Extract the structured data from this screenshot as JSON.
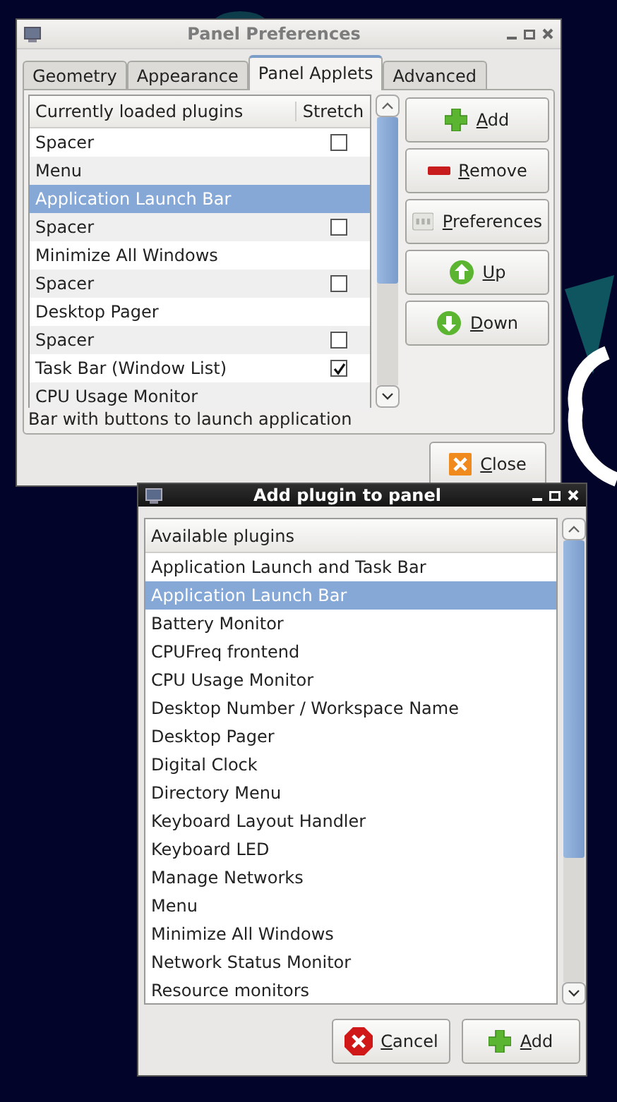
{
  "panel_preferences": {
    "title": "Panel Preferences",
    "tabs": [
      {
        "label": "Geometry",
        "selected": false
      },
      {
        "label": "Appearance",
        "selected": false
      },
      {
        "label": "Panel Applets",
        "selected": true
      },
      {
        "label": "Advanced",
        "selected": false
      }
    ],
    "plugin_list": {
      "columns": [
        "Currently loaded plugins",
        "Stretch"
      ],
      "rows": [
        {
          "name": "Spacer",
          "kind": "stretchable",
          "checked": false,
          "selected": false
        },
        {
          "name": "Menu",
          "kind": "plain",
          "selected": false
        },
        {
          "name": "Application Launch Bar",
          "kind": "plain",
          "selected": true
        },
        {
          "name": "Spacer",
          "kind": "stretchable",
          "checked": false,
          "selected": false
        },
        {
          "name": "Minimize All Windows",
          "kind": "plain",
          "selected": false
        },
        {
          "name": "Spacer",
          "kind": "stretchable",
          "checked": false,
          "selected": false
        },
        {
          "name": "Desktop Pager",
          "kind": "plain",
          "selected": false
        },
        {
          "name": "Spacer",
          "kind": "stretchable",
          "checked": false,
          "selected": false
        },
        {
          "name": "Task Bar (Window List)",
          "kind": "stretchable",
          "checked": true,
          "selected": false
        },
        {
          "name": "CPU Usage Monitor",
          "kind": "plain",
          "selected": false
        }
      ]
    },
    "buttons": [
      {
        "label": "Add",
        "kind": "add"
      },
      {
        "label": "Remove",
        "kind": "remove"
      },
      {
        "label": "Preferences",
        "kind": "preferences"
      },
      {
        "label": "Up",
        "kind": "up"
      },
      {
        "label": "Down",
        "kind": "down"
      }
    ],
    "description": "Bar with buttons to launch application",
    "close_button": {
      "label": "Close",
      "kind": "close"
    }
  },
  "add_plugin": {
    "title": "Add plugin to panel",
    "list": {
      "header": "Available plugins",
      "rows": [
        {
          "name": "Application Launch and Task Bar",
          "selected": false
        },
        {
          "name": "Application Launch Bar",
          "selected": true
        },
        {
          "name": "Battery Monitor",
          "selected": false
        },
        {
          "name": "CPUFreq frontend",
          "selected": false
        },
        {
          "name": "CPU Usage Monitor",
          "selected": false
        },
        {
          "name": "Desktop Number / Workspace Name",
          "selected": false
        },
        {
          "name": "Desktop Pager",
          "selected": false
        },
        {
          "name": "Digital Clock",
          "selected": false
        },
        {
          "name": "Directory Menu",
          "selected": false
        },
        {
          "name": "Keyboard Layout Handler",
          "selected": false
        },
        {
          "name": "Keyboard LED",
          "selected": false
        },
        {
          "name": "Manage Networks",
          "selected": false
        },
        {
          "name": "Menu",
          "selected": false
        },
        {
          "name": "Minimize All Windows",
          "selected": false
        },
        {
          "name": "Network Status Monitor",
          "selected": false
        },
        {
          "name": "Resource monitors",
          "selected": false
        }
      ]
    },
    "buttons": [
      {
        "label": "Cancel",
        "kind": "cancel"
      },
      {
        "label": "Add",
        "kind": "add"
      }
    ]
  }
}
